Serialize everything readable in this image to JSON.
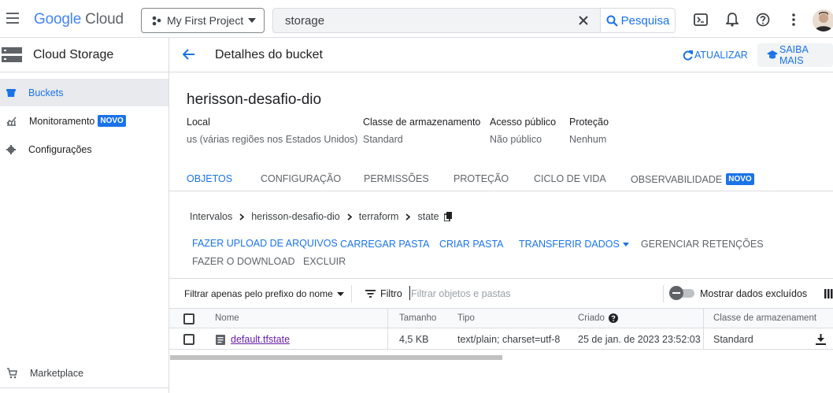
{
  "topbar": {
    "logo_google": "Google",
    "logo_cloud": "Cloud",
    "project": "My First Project",
    "search_value": "storage",
    "search_button": "Pesquisa"
  },
  "sidenav": {
    "product": "Cloud Storage",
    "items": [
      {
        "label": "Buckets",
        "icon": "bucket-icon",
        "active": true
      },
      {
        "label": "Monitoramento",
        "icon": "chart-icon",
        "badge": "NOVO"
      },
      {
        "label": "Configurações",
        "icon": "gear-icon"
      }
    ],
    "marketplace": "Marketplace"
  },
  "header": {
    "title": "Detalhes do bucket",
    "refresh": "ATUALIZAR",
    "learn_more": "SAIBA MAIS"
  },
  "bucket": {
    "name": "herisson-desafio-dio",
    "props": [
      {
        "label": "Local",
        "value": "us (várias regiões nos Estados Unidos)"
      },
      {
        "label": "Classe de armazenamento",
        "value": "Standard"
      },
      {
        "label": "Acesso público",
        "value": "Não público"
      },
      {
        "label": "Proteção",
        "value": "Nenhum"
      }
    ]
  },
  "tabs": [
    {
      "label": "OBJETOS",
      "active": true
    },
    {
      "label": "CONFIGURAÇÃO"
    },
    {
      "label": "PERMISSÕES"
    },
    {
      "label": "PROTEÇÃO"
    },
    {
      "label": "CICLO DE VIDA"
    },
    {
      "label": "OBSERVABILIDADE",
      "badge": "NOVO"
    }
  ],
  "breadcrumb": [
    "Intervalos",
    "herisson-desafio-dio",
    "terraform",
    "state"
  ],
  "actions": {
    "upload_files": "FAZER UPLOAD DE ARQUIVOS",
    "upload_folder": "CARREGAR PASTA",
    "create_folder": "CRIAR PASTA",
    "transfer": "TRANSFERIR DADOS",
    "retention": "GERENCIAR RETENÇÕES",
    "download": "FAZER O DOWNLOAD",
    "delete": "EXCLUIR"
  },
  "filter": {
    "prefix_mode": "Filtrar apenas pelo prefixo do nome",
    "label": "Filtro",
    "placeholder": "Filtrar objetos e pastas",
    "show_deleted": "Mostrar dados excluídos"
  },
  "table": {
    "headers": [
      "Nome",
      "Tamanho",
      "Tipo",
      "Criado",
      "Classe de armazenament"
    ],
    "rows": [
      {
        "name": "default.tfstate",
        "size": "4,5 KB",
        "type": "text/plain; charset=utf-8",
        "created": "25 de jan. de 2023 23:52:03",
        "class": "Standard"
      }
    ]
  },
  "colors": {
    "accent": "#1a73e8",
    "badge": "#1a73e8",
    "link": "#681da8"
  }
}
